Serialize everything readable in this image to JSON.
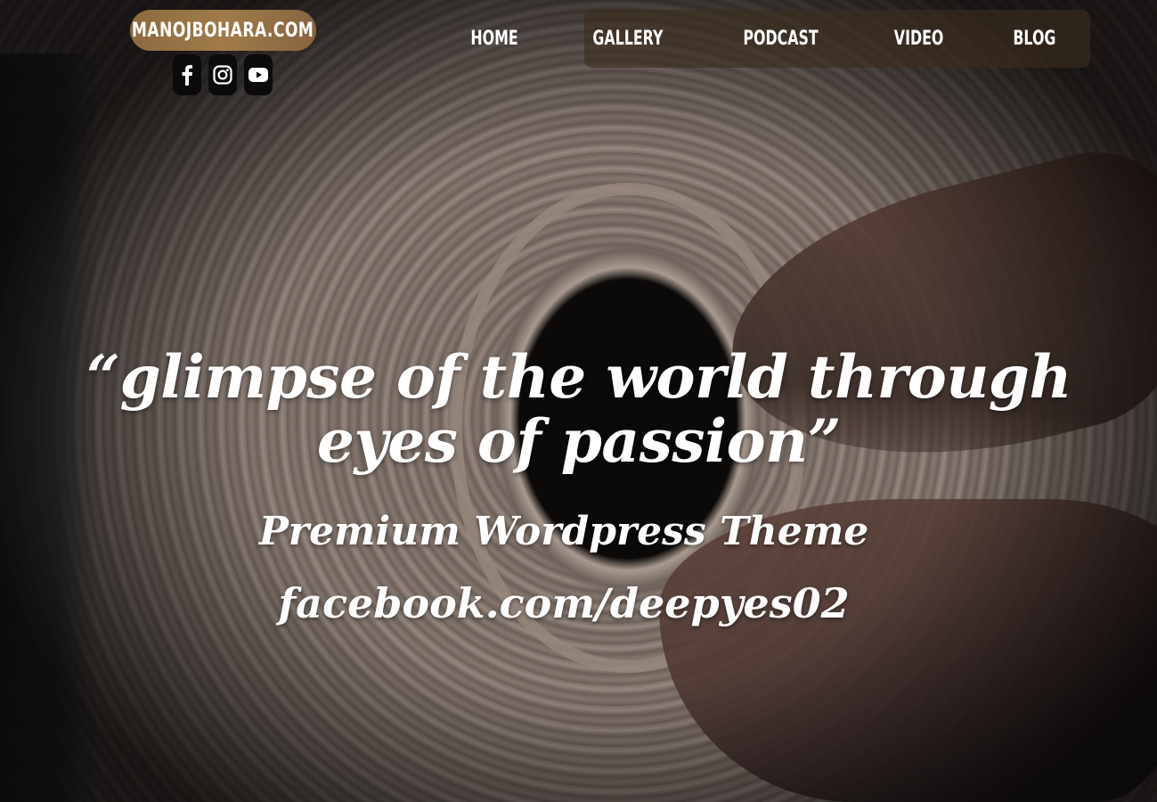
{
  "logo": {
    "text": "MANOJBOHARA.COM"
  },
  "social": [
    {
      "icon": "facebook-icon"
    },
    {
      "icon": "instagram-icon"
    },
    {
      "icon": "youtube-icon"
    }
  ],
  "nav": {
    "items": [
      {
        "label": "HOME"
      },
      {
        "label": "GALLERY"
      },
      {
        "label": "PODCAST"
      },
      {
        "label": "VIDEO"
      },
      {
        "label": "BLOG"
      }
    ]
  },
  "hero": {
    "headline": "“glimpse of the world through eyes of passion”",
    "subtitle": "Premium Wordpress Theme",
    "link_text": "facebook.com/deepyes02"
  },
  "colors": {
    "logo_pill": "#9a7646",
    "nav_bg": "#3c2d1e",
    "social_bg": "#0b0b0b",
    "text": "#ffffff"
  }
}
